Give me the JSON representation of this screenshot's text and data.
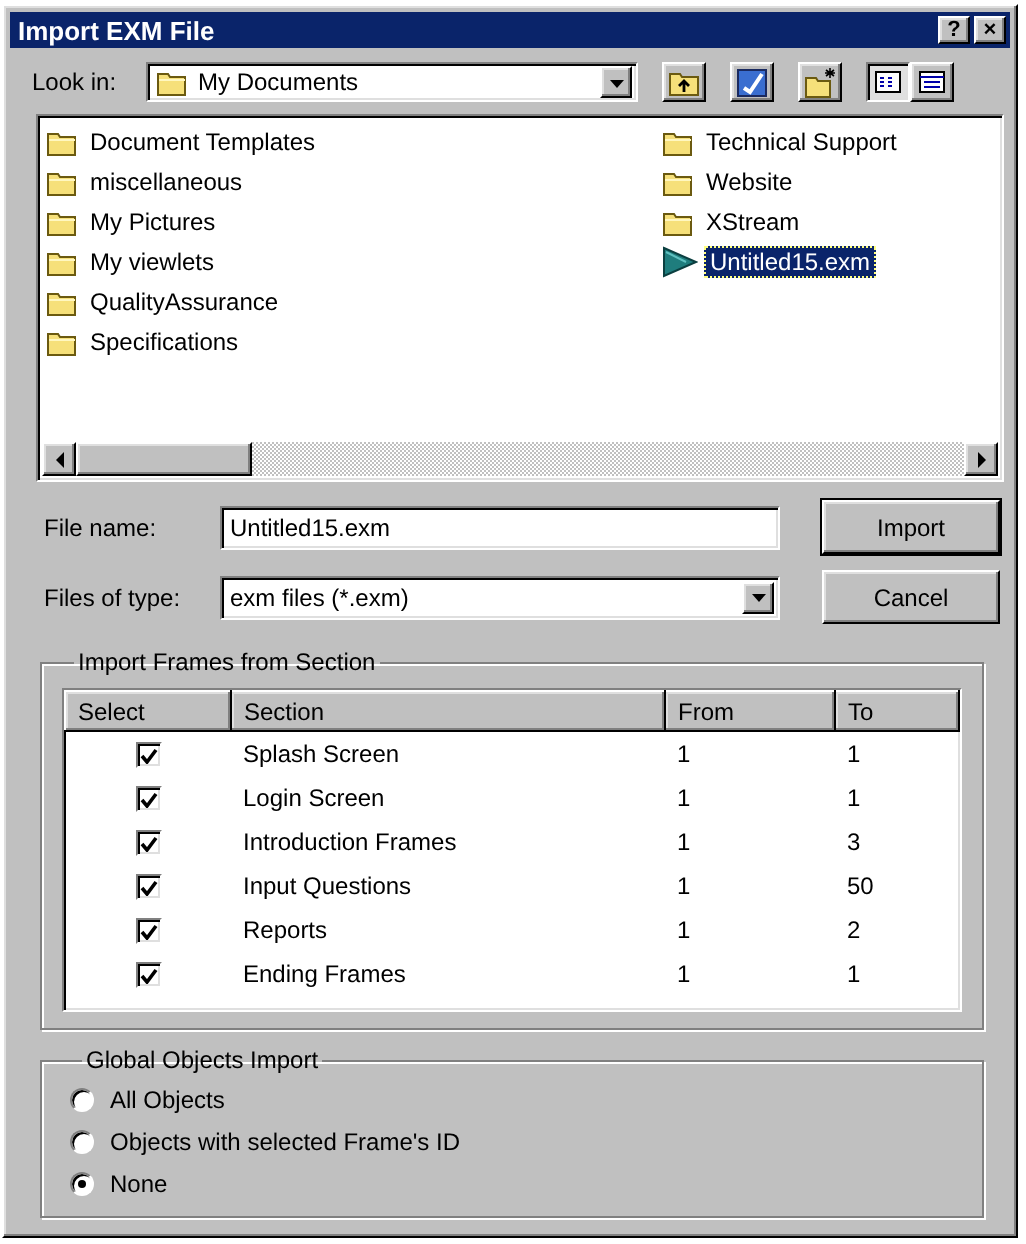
{
  "window": {
    "title": "Import EXM File",
    "help_button": "?",
    "close_button": "×"
  },
  "look_in": {
    "label": "Look in:",
    "value": "My Documents",
    "views": [
      {
        "kind": "list",
        "selected": true
      },
      {
        "kind": "details",
        "selected": false
      }
    ]
  },
  "files": [
    {
      "name": "Document Templates",
      "kind": "folder",
      "selected": false
    },
    {
      "name": "miscellaneous",
      "kind": "folder",
      "selected": false
    },
    {
      "name": "My Pictures",
      "kind": "folder",
      "selected": false
    },
    {
      "name": "My viewlets",
      "kind": "folder",
      "selected": false
    },
    {
      "name": "QualityAssurance",
      "kind": "folder",
      "selected": false
    },
    {
      "name": "Specifications",
      "kind": "folder",
      "selected": false
    },
    {
      "name": "Technical Support",
      "kind": "folder",
      "selected": false
    },
    {
      "name": "Website",
      "kind": "folder",
      "selected": false
    },
    {
      "name": "XStream",
      "kind": "folder",
      "selected": false
    },
    {
      "name": "Untitled15.exm",
      "kind": "file",
      "selected": true
    }
  ],
  "file_name": {
    "label": "File name:",
    "value": "Untitled15.exm"
  },
  "file_type": {
    "label": "Files of type:",
    "value": "exm files (*.exm)"
  },
  "buttons": [
    "Import",
    "Cancel"
  ],
  "sections": {
    "title": "Import Frames from Section",
    "columns": [
      "Select",
      "Section",
      "From",
      "To"
    ],
    "rows": [
      {
        "checked": true,
        "section": "Splash Screen",
        "from": "1",
        "to": "1"
      },
      {
        "checked": true,
        "section": "Login Screen",
        "from": "1",
        "to": "1"
      },
      {
        "checked": true,
        "section": "Introduction Frames",
        "from": "1",
        "to": "3"
      },
      {
        "checked": true,
        "section": "Input Questions",
        "from": "1",
        "to": "50"
      },
      {
        "checked": true,
        "section": "Reports",
        "from": "1",
        "to": "2"
      },
      {
        "checked": true,
        "section": "Ending Frames",
        "from": "1",
        "to": "1"
      }
    ]
  },
  "global_objects": {
    "title": "Global Objects Import",
    "options": [
      {
        "label": "All Objects",
        "selected": false
      },
      {
        "label": "Objects with selected Frame's ID",
        "selected": false
      },
      {
        "label": "None",
        "selected": true
      }
    ]
  }
}
